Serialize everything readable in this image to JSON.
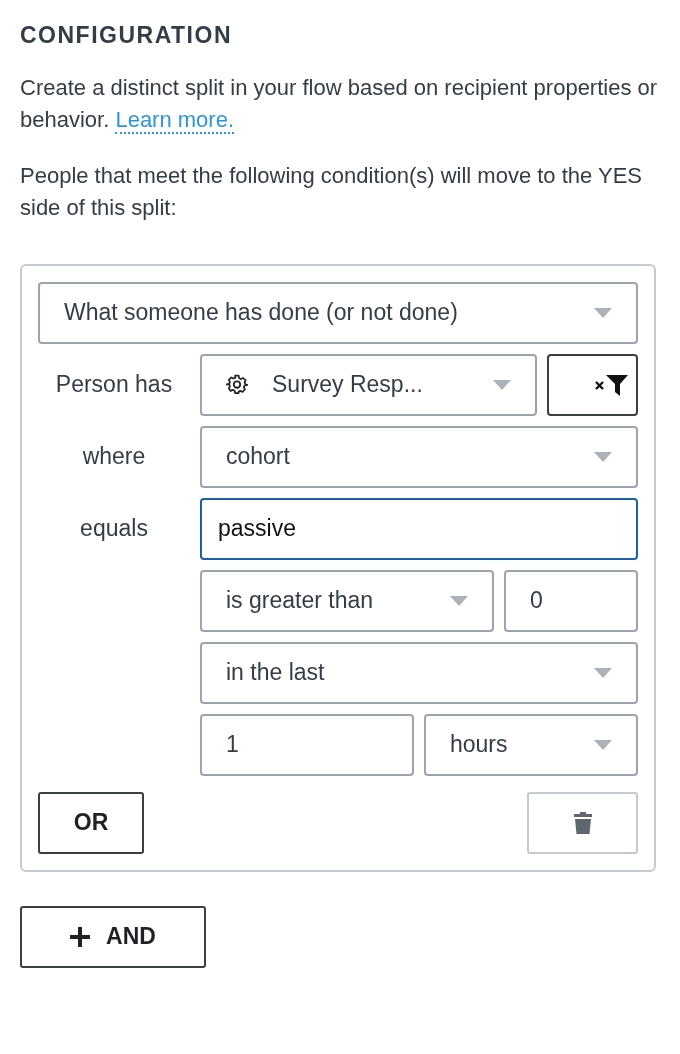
{
  "heading": "CONFIGURATION",
  "intro": {
    "text": "Create a distinct split in your flow based on recipient properties or behavior.",
    "link": "Learn more."
  },
  "instruction": "People that meet the following condition(s) will move to the YES side of this split:",
  "condition": {
    "type_select": {
      "value": "What someone has done (or not done)"
    },
    "rows": [
      {
        "label": "Person has",
        "controls": [
          {
            "kind": "icon-select",
            "value": "Survey Resp..."
          },
          {
            "kind": "filter-button"
          }
        ]
      },
      {
        "label": "where",
        "controls": [
          {
            "kind": "select",
            "value": "cohort"
          }
        ]
      },
      {
        "label": "equals",
        "controls": [
          {
            "kind": "input",
            "value": "passive",
            "focused": true
          }
        ]
      },
      {
        "controls": [
          {
            "kind": "select",
            "value": "is greater than"
          },
          {
            "kind": "input",
            "value": "0",
            "focused": false
          }
        ]
      },
      {
        "controls": [
          {
            "kind": "select",
            "value": "in the last"
          }
        ]
      },
      {
        "controls": [
          {
            "kind": "input",
            "value": "1",
            "focused": false
          },
          {
            "kind": "select",
            "value": "hours"
          }
        ]
      }
    ],
    "or_button": "OR"
  },
  "and_button": "AND"
}
